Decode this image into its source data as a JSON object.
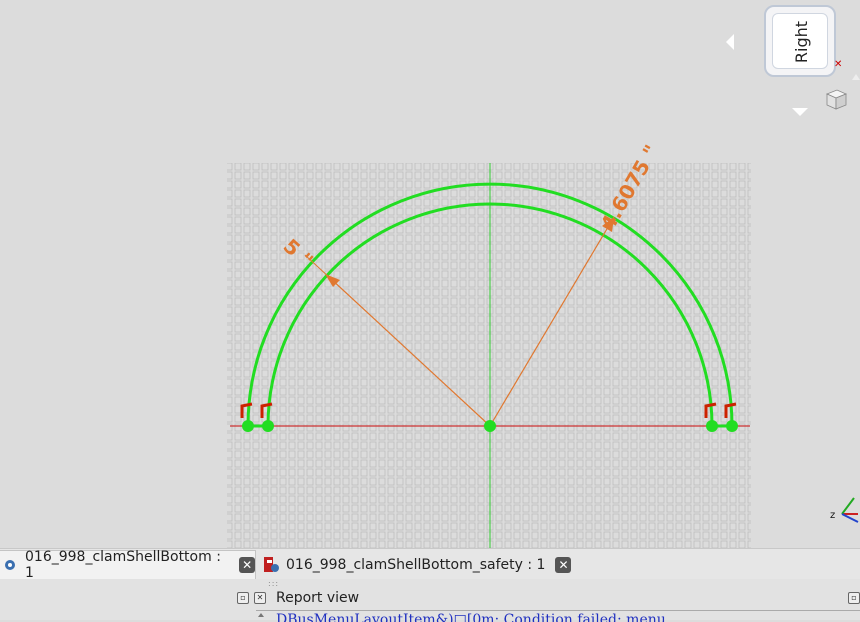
{
  "viewport": {
    "dimension_radius_label": "5 \"",
    "dimension_radius_label2": "4.6075 \""
  },
  "navcube": {
    "face_label": "Right"
  },
  "tabs": [
    {
      "label": "016_998_clamShellBottom : 1",
      "active": true
    },
    {
      "label": "016_998_clamShellBottom_safety : 1",
      "active": false
    }
  ],
  "report": {
    "title": "Report view",
    "first_line": "DBusMenuLayoutItem&)□[0m: Condition failed: menu"
  },
  "colors": {
    "geometry": "#22dd22",
    "dimension": "#e07830",
    "horizontal_axis": "#cc3333",
    "vertical_axis": "#33cc33",
    "background": "#dcdcdc"
  }
}
